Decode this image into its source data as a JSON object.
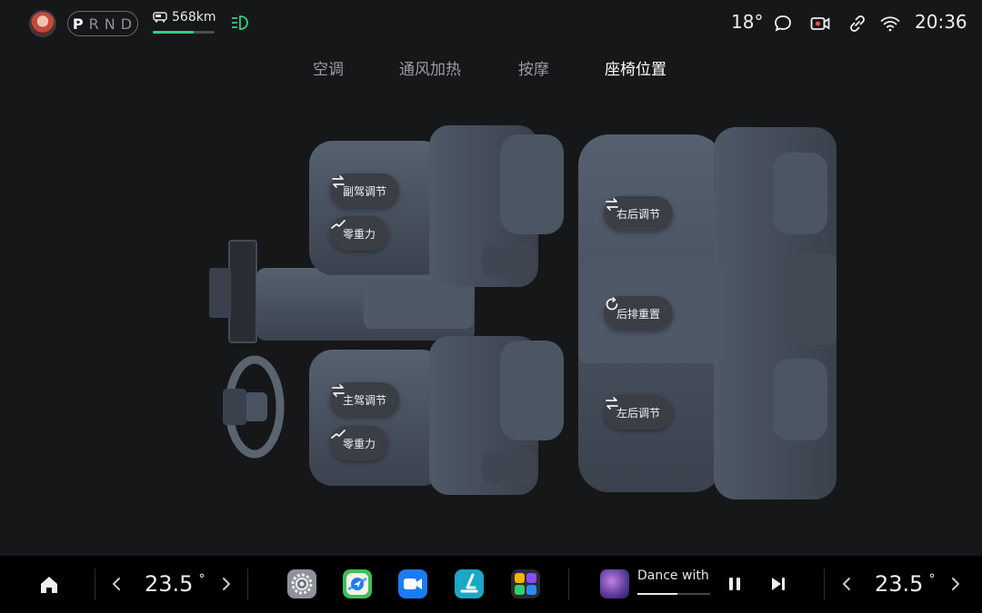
{
  "status": {
    "gears": [
      "P",
      "R",
      "N",
      "D"
    ],
    "active_gear": "P",
    "range_text": "568km",
    "range_fraction": 0.66,
    "outside_temp": "18°",
    "time": "20:36"
  },
  "tabs": [
    {
      "label": "空调",
      "active": false
    },
    {
      "label": "通风加热",
      "active": false
    },
    {
      "label": "按摩",
      "active": false
    },
    {
      "label": "座椅位置",
      "active": true
    }
  ],
  "seat_controls": {
    "passenger_adjust": "副驾调节",
    "passenger_zero_g": "零重力",
    "driver_adjust": "主驾调节",
    "driver_zero_g": "零重力",
    "rear_right_adjust": "右后调节",
    "rear_reset": "后排重置",
    "rear_left_adjust": "左后调节"
  },
  "dock": {
    "left_temp": "23.5",
    "right_temp": "23.5",
    "temp_unit": "°",
    "apps": [
      "settings-app",
      "navigation-app",
      "video-call-app",
      "seat-app",
      "app-launcher"
    ],
    "song_title": "Dance with",
    "song_progress": 0.55
  },
  "colors": {
    "accent_green": "#2fd085",
    "record_red": "#ff4d4f",
    "pill_bg": "#3b3e45",
    "seat_body": "#4a5361"
  }
}
